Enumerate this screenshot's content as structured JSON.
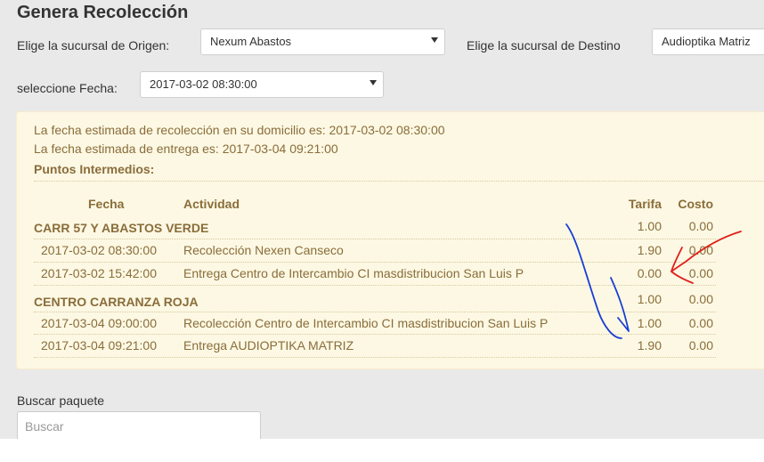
{
  "title": "Genera Recolección",
  "origin": {
    "label": "Elige la sucursal de Origen:",
    "value": "Nexum Abastos"
  },
  "destination": {
    "label": "Elige la sucursal de Destino",
    "value": "Audioptika Matriz"
  },
  "date": {
    "label": "seleccione Fecha:",
    "value": "2017-03-02 08:30:00"
  },
  "info": {
    "pickup": "La fecha estimada de recolección en su domicilio es: 2017-03-02 08:30:00",
    "delivery": "La fecha estimada de entrega es: 2017-03-04 09:21:00",
    "intermediate": "Puntos Intermedios:"
  },
  "table": {
    "headers": [
      "Fecha",
      "Actividad",
      "Tarifa",
      "Costo"
    ],
    "groups": [
      {
        "name": "CARR 57 Y ABASTOS VERDE",
        "tarifa": "1.00",
        "costo": "0.00",
        "rows": [
          {
            "fecha": "2017-03-02 08:30:00",
            "actividad": "Recolección Nexen Canseco",
            "tarifa": "1.90",
            "costo": "0.00"
          },
          {
            "fecha": "2017-03-02 15:42:00",
            "actividad": "Entrega Centro de Intercambio CI masdistribucion San Luis P",
            "tarifa": "0.00",
            "costo": "0.00"
          }
        ]
      },
      {
        "name": "CENTRO CARRANZA ROJA",
        "tarifa": "1.00",
        "costo": "0.00",
        "rows": [
          {
            "fecha": "2017-03-04 09:00:00",
            "actividad": "Recolección Centro de Intercambio CI masdistribucion San Luis P",
            "tarifa": "1.00",
            "costo": "0.00"
          },
          {
            "fecha": "2017-03-04 09:21:00",
            "actividad": "Entrega AUDIOPTIKA MATRIZ",
            "tarifa": "1.90",
            "costo": "0.00"
          }
        ]
      }
    ]
  },
  "search": {
    "label": "Buscar paquete",
    "placeholder": "Buscar"
  },
  "colors": {
    "annotation_blue": "#1a3fd6",
    "annotation_red": "#e0201a",
    "alert_text": "#8a6d3b",
    "alert_bg": "#fcf8e3"
  }
}
